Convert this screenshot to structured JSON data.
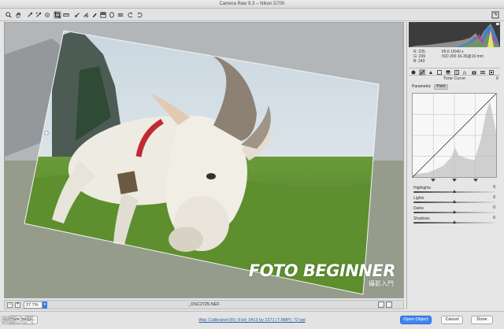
{
  "window": {
    "title": "Camera Raw 9.3  –  Nikon D700"
  },
  "toolbar": {
    "tools": [
      "zoom-icon",
      "hand-icon",
      "white-balance-icon",
      "color-sampler-icon",
      "targeted-adjust-icon",
      "crop-icon",
      "straighten-icon",
      "spot-removal-icon",
      "red-eye-icon",
      "adjustment-brush-icon",
      "graduated-filter-icon",
      "radial-filter-icon",
      "preferences-icon",
      "rotate-ccw-icon",
      "rotate-cw-icon"
    ],
    "active_tool": "straighten-icon"
  },
  "canvas": {
    "watermark": "FOTO BEGINNER",
    "watermark_sub": "攝影入門"
  },
  "status": {
    "zoom": "27.7%",
    "filename": "_DSC2725.NEF"
  },
  "readout": {
    "r": "R: 235",
    "g": "G: 239",
    "b": "B: 243",
    "exposure": "f/5.6   1/640 s",
    "iso": "ISO 200   16-35@16 mm"
  },
  "panel": {
    "section_title": "Tone Curve",
    "sub_tabs": [
      "Parametric",
      "Point"
    ],
    "active_sub_tab": "Parametric",
    "sliders": [
      {
        "label": "Highlights",
        "value": "0",
        "fraction": 0.5
      },
      {
        "label": "Lights",
        "value": "0",
        "fraction": 0.5
      },
      {
        "label": "Darks",
        "value": "0",
        "fraction": 0.5
      },
      {
        "label": "Shadows",
        "value": "0",
        "fraction": 0.5
      }
    ]
  },
  "footer": {
    "save_label": "Save Image...",
    "workflow_link": "Wac Calibrated (R); 8 bit; 3413 by 2271 (7.8MP); 72 ppi",
    "open_label": "Open Object",
    "cancel_label": "Cancel",
    "done_label": "Done"
  },
  "corner_watermark": "攝影入門",
  "colors": {
    "accent": "#3f86f0",
    "panel": "#e6e6e6"
  }
}
